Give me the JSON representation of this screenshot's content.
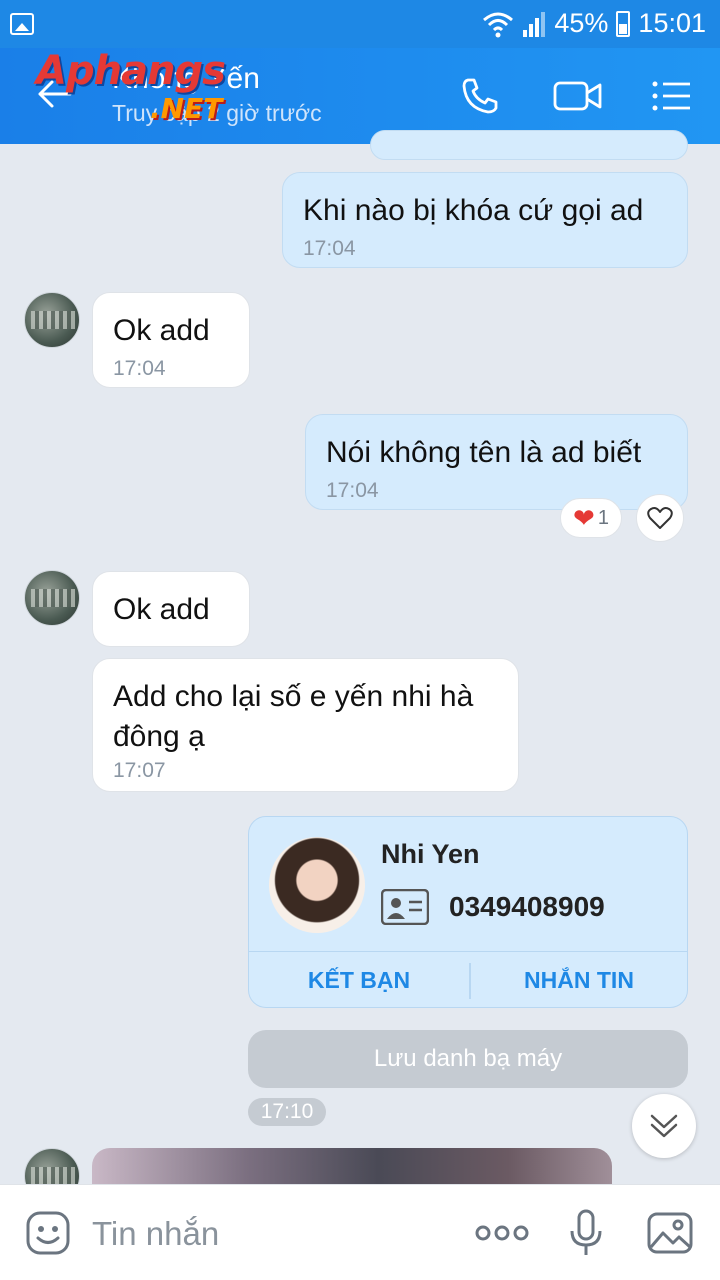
{
  "status_bar": {
    "battery": "45%",
    "time": "15:01"
  },
  "header": {
    "title": "Khổng Yến",
    "subtitle": "Truy cập 2 giờ trước",
    "watermark_main": "Aphangs",
    "watermark_sub": ".NET",
    "icons": [
      "back-arrow-icon",
      "phone-icon",
      "video-call-icon",
      "menu-list-icon"
    ]
  },
  "messages": [
    {
      "side": "out",
      "text": "Khi nào bị khóa cứ gọi ad",
      "time": "17:04"
    },
    {
      "side": "in",
      "text": "Ok add",
      "time": "17:04"
    },
    {
      "side": "out",
      "text": "Nói không tên là ad biết",
      "time": "17:04",
      "reaction": {
        "emoji": "❤",
        "count": "1"
      }
    },
    {
      "side": "in",
      "text": "Ok add",
      "time": ""
    },
    {
      "side": "in",
      "text_line1": "Add cho lại số e yến nhi hà",
      "text_line2": "đông ạ",
      "time": "17:07"
    }
  ],
  "contact_card": {
    "name": "Nhi Yen",
    "phone": "0349408909",
    "add_friend_label": "KẾT BẠN",
    "message_label": "NHẮN TIN"
  },
  "save_contact_label": "Lưu danh bạ máy",
  "time_stamp": "17:10",
  "composer": {
    "placeholder": "Tin nhắn"
  },
  "colors": {
    "header": "#1e88e5",
    "outgoing": "#d5ebfd",
    "incoming": "#ffffff",
    "accent": "#1e88e5",
    "background": "#e4e9f0"
  }
}
